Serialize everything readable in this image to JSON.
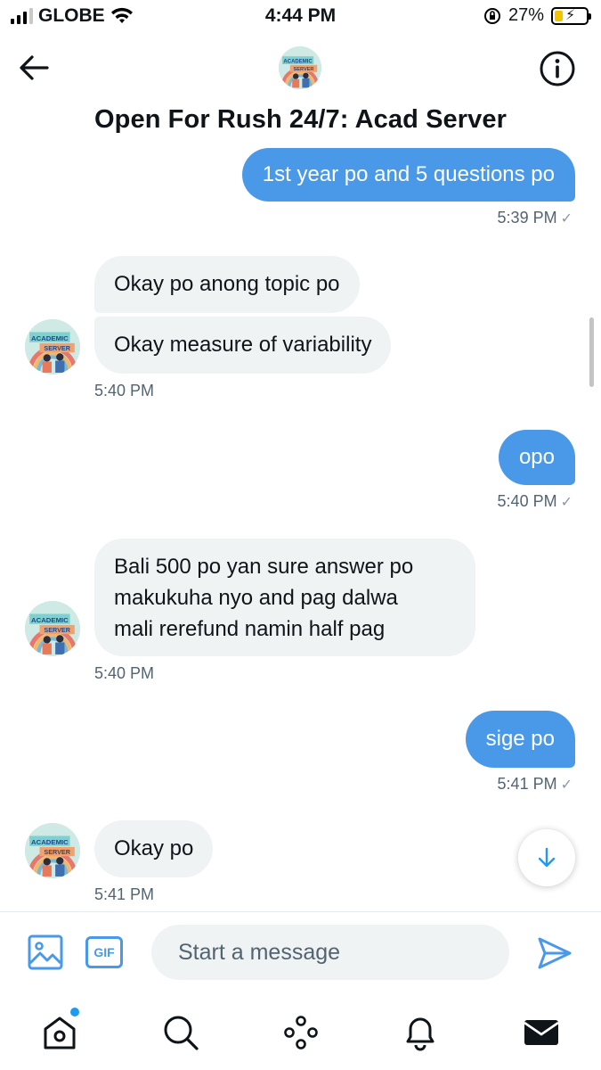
{
  "status_bar": {
    "carrier": "GLOBE",
    "time": "4:44 PM",
    "battery_percent": "27%",
    "battery_level": 0.27
  },
  "header": {
    "title": "Open For Rush 24/7: Acad Server",
    "avatar_text_top": "ACADEMIC",
    "avatar_text_bottom": "SERVER"
  },
  "messages": [
    {
      "direction": "out",
      "text": "1st year po and 5 questions po",
      "time": "5:39 PM",
      "seen_mark": "✓"
    },
    {
      "direction": "in",
      "text": "Okay po anong topic po"
    },
    {
      "direction": "in",
      "text": "Okay measure of variability",
      "time": "5:40 PM"
    },
    {
      "direction": "out",
      "text": "opo",
      "time": "5:40 PM",
      "seen_mark": "✓"
    },
    {
      "direction": "in",
      "text_lines": [
        "Bali 500 po yan sure answer po",
        "makukuha nyo and pag dalwa",
        "mali rerefund namin half pag"
      ],
      "time": "5:40 PM"
    },
    {
      "direction": "out",
      "text": "sige po",
      "time": "5:41 PM",
      "seen_mark": "✓"
    },
    {
      "direction": "in",
      "text": "Okay po",
      "time": "5:41 PM"
    }
  ],
  "composer": {
    "placeholder": "Start a message",
    "gif_label": "GIF"
  },
  "colors": {
    "accent": "#1d9bf0",
    "outgoing_bubble": "#4a99e9",
    "incoming_bubble": "#eff3f4",
    "muted_text": "#536471"
  },
  "icons": {
    "back": "arrow-left-icon",
    "info": "info-circle-icon",
    "scroll_down": "arrow-down-icon",
    "media": "image-icon",
    "send": "send-icon",
    "tabs": [
      "home-icon",
      "search-icon",
      "spaces-icon",
      "bell-icon",
      "mail-icon"
    ]
  }
}
